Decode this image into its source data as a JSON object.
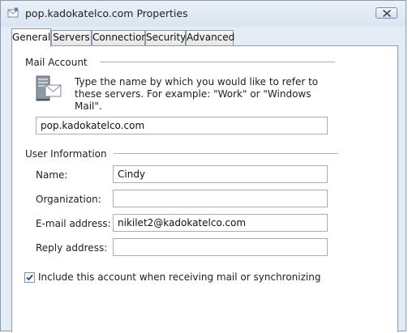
{
  "window": {
    "title": "pop.kadokatelco.com Properties"
  },
  "tabs": [
    {
      "label": "General",
      "active": true
    },
    {
      "label": "Servers",
      "active": false
    },
    {
      "label": "Connection",
      "active": false
    },
    {
      "label": "Security",
      "active": false
    },
    {
      "label": "Advanced",
      "active": false
    }
  ],
  "mail_account": {
    "group_title": "Mail Account",
    "description": "Type the name by which you would like to refer to these servers.  For example: \"Work\" or \"Windows Mail\".",
    "account_name_value": "pop.kadokatelco.com",
    "icon": "mail-server-icon"
  },
  "user_information": {
    "group_title": "User Information",
    "name_label": "Name:",
    "name_value": "Cindy",
    "organization_label": "Organization:",
    "organization_value": "",
    "email_label": "E-mail address:",
    "email_value": "nikilet2@kadokatelco.com",
    "reply_label": "Reply address:",
    "reply_value": ""
  },
  "include_account": {
    "label": "Include this account when receiving mail or synchronizing",
    "checked": true
  }
}
